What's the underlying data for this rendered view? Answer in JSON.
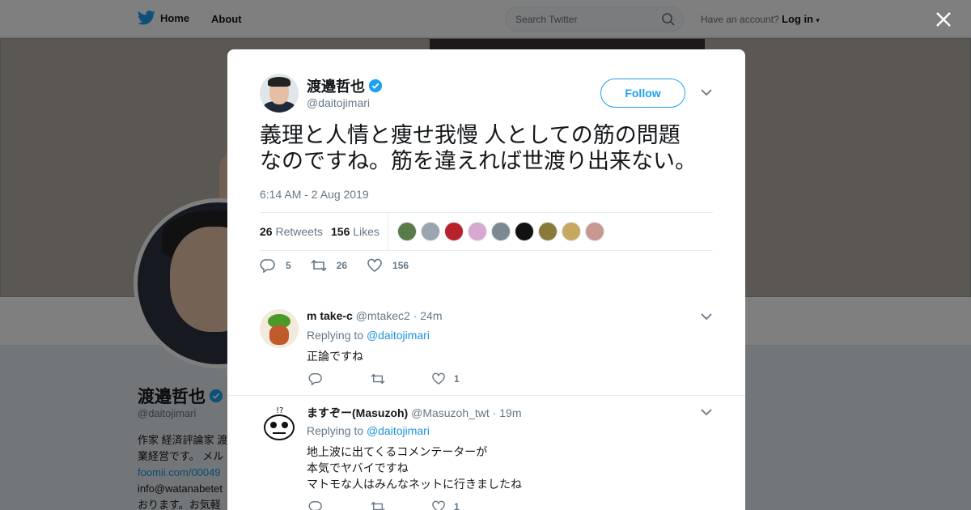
{
  "nav": {
    "home_label": "Home",
    "about_label": "About",
    "search_placeholder": "Search Twitter",
    "account_prompt": "Have an account?",
    "login_label": "Log in"
  },
  "profile": {
    "name": "渡邉哲也",
    "handle": "@daitojimari",
    "bio_lines": [
      "作家 経済評論家 渡",
      "業経営です。 メル",
      "foomii.com/00049",
      "info@watanabetet",
      "おります。お気軽"
    ]
  },
  "tweet": {
    "author_name": "渡邉哲也",
    "author_handle": "@daitojimari",
    "follow_label": "Follow",
    "text_line1": "義理と人情と痩せ我慢 人としての筋の問題",
    "text_line2": "なのですね。筋を違えれば世渡り出来ない。",
    "timestamp": "6:14 AM - 2 Aug 2019",
    "retweets_count": "26",
    "retweets_label": "Retweets",
    "likes_count": "156",
    "likes_label": "Likes",
    "reply_count": "5",
    "retweet_action_count": "26",
    "like_action_count": "156"
  },
  "likers": [
    "#5a7a4a",
    "#9aa5ad",
    "#b8202c",
    "#d8a8d0",
    "#7a8a90",
    "#111111",
    "#8a7a3a",
    "#c8a860",
    "#c89890"
  ],
  "replies": [
    {
      "name": "m take-c",
      "handle": "@mtakec2",
      "time": "· 24m",
      "replying_to_prefix": "Replying to",
      "replying_to": "@daitojimari",
      "lines": [
        "正論ですね"
      ],
      "likes": "1",
      "avatar_color": "#c05a2a"
    },
    {
      "name": "ますぞー(Masuzoh)",
      "handle": "@Masuzoh_twt",
      "time": "· 19m",
      "replying_to_prefix": "Replying to",
      "replying_to": "@daitojimari",
      "lines": [
        "地上波に出てくるコメンテーターが",
        "本気でヤバイですね",
        "マトモな人はみんなネットに行きましたね"
      ],
      "likes": "1",
      "avatar_color": "#ffffff"
    }
  ],
  "colors": {
    "accent": "#1da1f2",
    "link": "#1b95e0",
    "secondary_text": "#657786",
    "verified": "#1da1f2"
  }
}
